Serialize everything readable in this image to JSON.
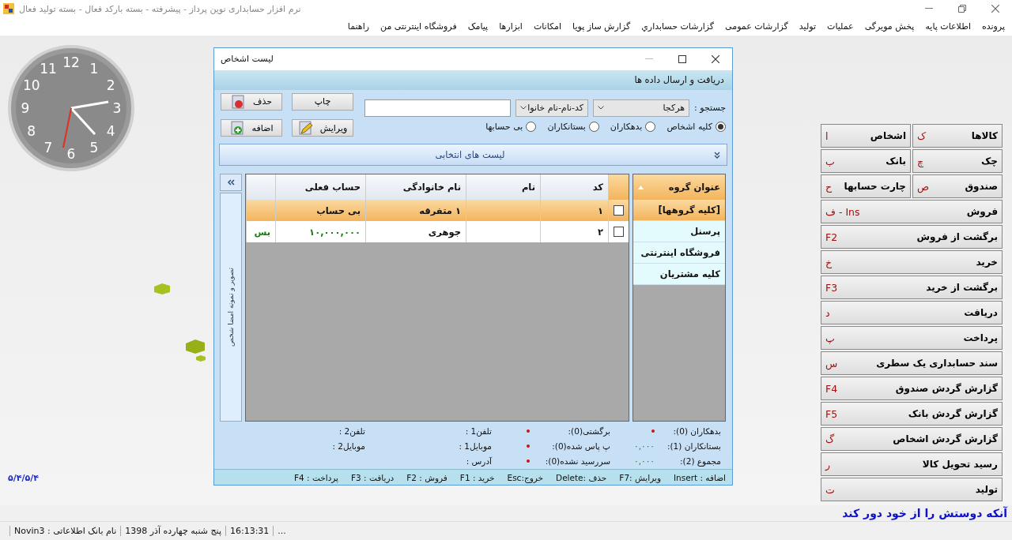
{
  "app_title": "نرم افزار حسابداری نوین پرداز - پیشرفته - بسته بارکد فعال - بسته تولید فعال",
  "menu": [
    "پرونده",
    "اطلاعات پایه",
    "پخش مویرگی",
    "عملیات",
    "تولید",
    "گزارشات عمومی",
    "گزارشات حسابداري",
    "گزارش ساز پویا",
    "امکانات",
    "ابزارها",
    "پیامک",
    "فروشگاه اینترنتی من",
    "راهنما"
  ],
  "clock_numerals": [
    "1",
    "12",
    "11",
    "2",
    "10",
    "3",
    "9",
    "4",
    "8",
    "5",
    "7",
    "6"
  ],
  "version": "۵/۴/۵/۴",
  "window": {
    "title": "لیست اشخاص",
    "header": "دریافت و ارسال داده ها",
    "search_label": "جستجو :",
    "search_scope": "هرکجا",
    "search_field": "کد-نام-نام خانوا",
    "filters": [
      {
        "label": "کلیه اشخاص",
        "selected": true
      },
      {
        "label": "بدهکاران",
        "selected": false
      },
      {
        "label": "بستانکاران",
        "selected": false
      },
      {
        "label": "بی حسابها",
        "selected": false
      }
    ],
    "buttons": [
      {
        "label": "چاپ",
        "kind": "print"
      },
      {
        "label": "حذف",
        "kind": "delete"
      },
      {
        "label": "ویرایش",
        "kind": "edit"
      },
      {
        "label": "اضافه",
        "kind": "add"
      }
    ],
    "selection_lists": "لیست های انتخابی",
    "side_tab": "تصویر و نمونه امضا شخص",
    "groups": {
      "title": "عنوان گروه",
      "items": [
        {
          "label": "[کلیه گروهها]",
          "selected": true
        },
        {
          "label": "پرسنل",
          "selected": false
        },
        {
          "label": "فروشگاه اینترنتی",
          "selected": false
        },
        {
          "label": "کلیه مشتریان",
          "selected": false
        }
      ]
    },
    "table": {
      "columns": [
        "کد",
        "نام",
        "نام خانوادگی",
        "حساب فعلی"
      ],
      "rows": [
        {
          "checked": false,
          "selected": true,
          "code": "۱",
          "family": "۱ متفرقه",
          "account": "بی حساب"
        },
        {
          "checked": false,
          "selected": false,
          "code": "۲",
          "family": "جوهری",
          "account": "۱۰,۰۰۰,۰۰۰",
          "status": "بس"
        }
      ]
    },
    "summary": [
      [
        {
          "label": "بدهکاران (0):",
          "kind": "dot"
        },
        {
          "label": "بستانکاران (1):",
          "kind": "amount",
          "value": "۰,۰۰۰"
        },
        {
          "label": "مجموع (2):",
          "kind": "amount",
          "value": "۰,۰۰۰"
        }
      ],
      [
        {
          "label": "برگشتی(0):",
          "kind": "dot"
        },
        {
          "label": "پ پاس شده(0):",
          "kind": "dot"
        },
        {
          "label": "سررسید نشده(0):",
          "kind": "dot"
        }
      ],
      [
        {
          "label": "تلفن1 :",
          "kind": "plain"
        },
        {
          "label": "موبایل1 :",
          "kind": "plain"
        },
        {
          "label": "آدرس :",
          "kind": "plain"
        }
      ],
      [
        {
          "label": "تلفن2 :",
          "kind": "plain"
        },
        {
          "label": "موبایل2 :",
          "kind": "plain"
        }
      ]
    ],
    "hotkeys": [
      "اضافه : Insert",
      "ویرایش :F7",
      "حذف :Delete",
      "خروج:Esc",
      "خرید : F1",
      "فروش : F2",
      "دریافت : F3",
      "پرداخت : F4"
    ]
  },
  "shortcuts": [
    {
      "buttons": [
        {
          "label": "کالاها",
          "key": "ک"
        },
        {
          "label": "اشخاص",
          "key": "ا"
        }
      ]
    },
    {
      "buttons": [
        {
          "label": "چک",
          "key": "چ"
        },
        {
          "label": "بانک",
          "key": "ب"
        }
      ]
    },
    {
      "buttons": [
        {
          "label": "صندوق",
          "key": "ص"
        },
        {
          "label": "چارت حسابها",
          "key": "ح"
        }
      ]
    },
    {
      "buttons": [
        {
          "label": "فروش",
          "key": "Ins - ف"
        }
      ]
    },
    {
      "buttons": [
        {
          "label": "برگشت از فروش",
          "key": "F2"
        }
      ]
    },
    {
      "buttons": [
        {
          "label": "خرید",
          "key": "خ"
        }
      ]
    },
    {
      "buttons": [
        {
          "label": "برگشت از خرید",
          "key": "F3"
        }
      ]
    },
    {
      "buttons": [
        {
          "label": "دریافت",
          "key": "د"
        }
      ]
    },
    {
      "buttons": [
        {
          "label": "پرداخت",
          "key": "پ"
        }
      ]
    },
    {
      "buttons": [
        {
          "label": "سند حسابداری یک سطری",
          "key": "س"
        }
      ]
    },
    {
      "buttons": [
        {
          "label": "گزارش گردش صندوق",
          "key": "F4"
        }
      ]
    },
    {
      "buttons": [
        {
          "label": "گزارش گردش بانک",
          "key": "F5"
        }
      ]
    },
    {
      "buttons": [
        {
          "label": "گزارش گردش اشخاص",
          "key": "گ"
        }
      ]
    },
    {
      "buttons": [
        {
          "label": "رسید تحویل کالا",
          "key": "ر"
        }
      ]
    },
    {
      "buttons": [
        {
          "label": "تولید",
          "key": "ت"
        }
      ]
    }
  ],
  "quote": "آنکه دوستش را از خود دور کند",
  "status_bar": [
    "...",
    "16:13:31",
    "پنج شنبه چهارده آذر 1398",
    "نام بانک اطلاعاتی : Novin3"
  ]
}
